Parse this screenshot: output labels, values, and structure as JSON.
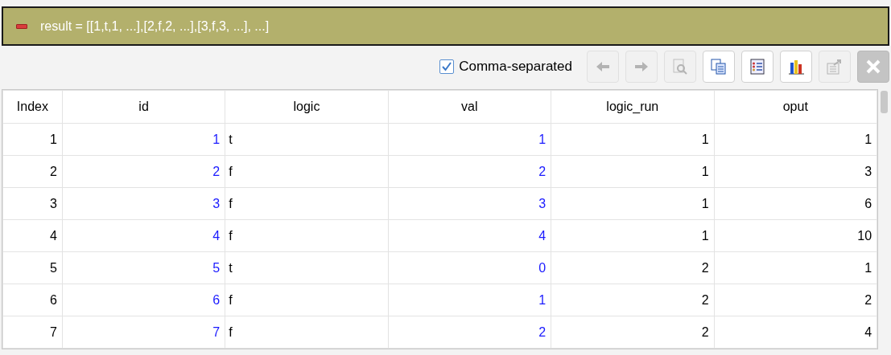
{
  "title_bar": {
    "text": "result = [[1,t,1, ...],[2,f,2, ...],[3,f,3, ...], ...]"
  },
  "toolbar": {
    "comma_separated": {
      "label": "Comma-separated",
      "checked": true
    },
    "buttons": [
      {
        "kind": "back",
        "disabled": true
      },
      {
        "kind": "forward",
        "disabled": true
      },
      {
        "kind": "preview",
        "disabled": true
      },
      {
        "kind": "copy",
        "disabled": false
      },
      {
        "kind": "list",
        "disabled": false
      },
      {
        "kind": "chart",
        "disabled": false
      },
      {
        "kind": "export",
        "disabled": true
      },
      {
        "kind": "close",
        "disabled": true
      }
    ]
  },
  "table": {
    "columns": [
      {
        "label": "Index",
        "kind": "index"
      },
      {
        "label": "id",
        "kind": "blue-number"
      },
      {
        "label": "logic",
        "kind": "text"
      },
      {
        "label": "val",
        "kind": "blue-number"
      },
      {
        "label": "logic_run",
        "kind": "number"
      },
      {
        "label": "oput",
        "kind": "number"
      }
    ],
    "rows": [
      [
        "1",
        "1",
        "t",
        "1",
        "1",
        "1"
      ],
      [
        "2",
        "2",
        "f",
        "2",
        "1",
        "3"
      ],
      [
        "3",
        "3",
        "f",
        "3",
        "1",
        "6"
      ],
      [
        "4",
        "4",
        "f",
        "4",
        "1",
        "10"
      ],
      [
        "5",
        "5",
        "t",
        "0",
        "2",
        "1"
      ],
      [
        "6",
        "6",
        "f",
        "1",
        "2",
        "2"
      ],
      [
        "7",
        "7",
        "f",
        "2",
        "2",
        "4"
      ]
    ]
  }
}
